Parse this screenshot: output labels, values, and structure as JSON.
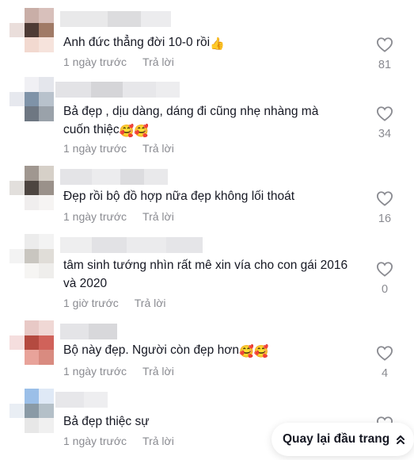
{
  "comments": [
    {
      "text": "Anh đức thẳng đời 10-0 rồi",
      "emoji": "👍",
      "time": "1 ngày trước",
      "reply": "Trả lời",
      "likes": "81"
    },
    {
      "text": "Bả đẹp , dịu dàng, dáng đi cũng nhẹ nhàng mà cuốn thiệc",
      "emoji": "🥰🥰",
      "time": "1 ngày trước",
      "reply": "Trả lời",
      "likes": "34"
    },
    {
      "text": "Đẹp rồi bộ đồ hợp nữa đẹp không lối thoát",
      "emoji": "",
      "time": "1 ngày trước",
      "reply": "Trả lời",
      "likes": "16"
    },
    {
      "text": "tâm sinh tướng nhìn rất mê xin vía cho con gái 2016 và 2020",
      "emoji": "",
      "time": "1 giờ trước",
      "reply": "Trả lời",
      "likes": "0"
    },
    {
      "text": "Bộ này đẹp. Người còn đẹp hơn",
      "emoji": "🥰🥰",
      "time": "1 ngày trước",
      "reply": "Trả lời",
      "likes": "4"
    },
    {
      "text": "Bả đẹp thiệc sự",
      "emoji": "",
      "time": "1 ngày trước",
      "reply": "Trả lời",
      "likes": ""
    }
  ],
  "back_to_top": "Quay lại đầu trang",
  "icons": {
    "like": "heart-outline-icon",
    "back_to_top": "chevron-double-up-icon"
  },
  "colors": {
    "text": "#161823",
    "muted": "#8a8b91"
  }
}
